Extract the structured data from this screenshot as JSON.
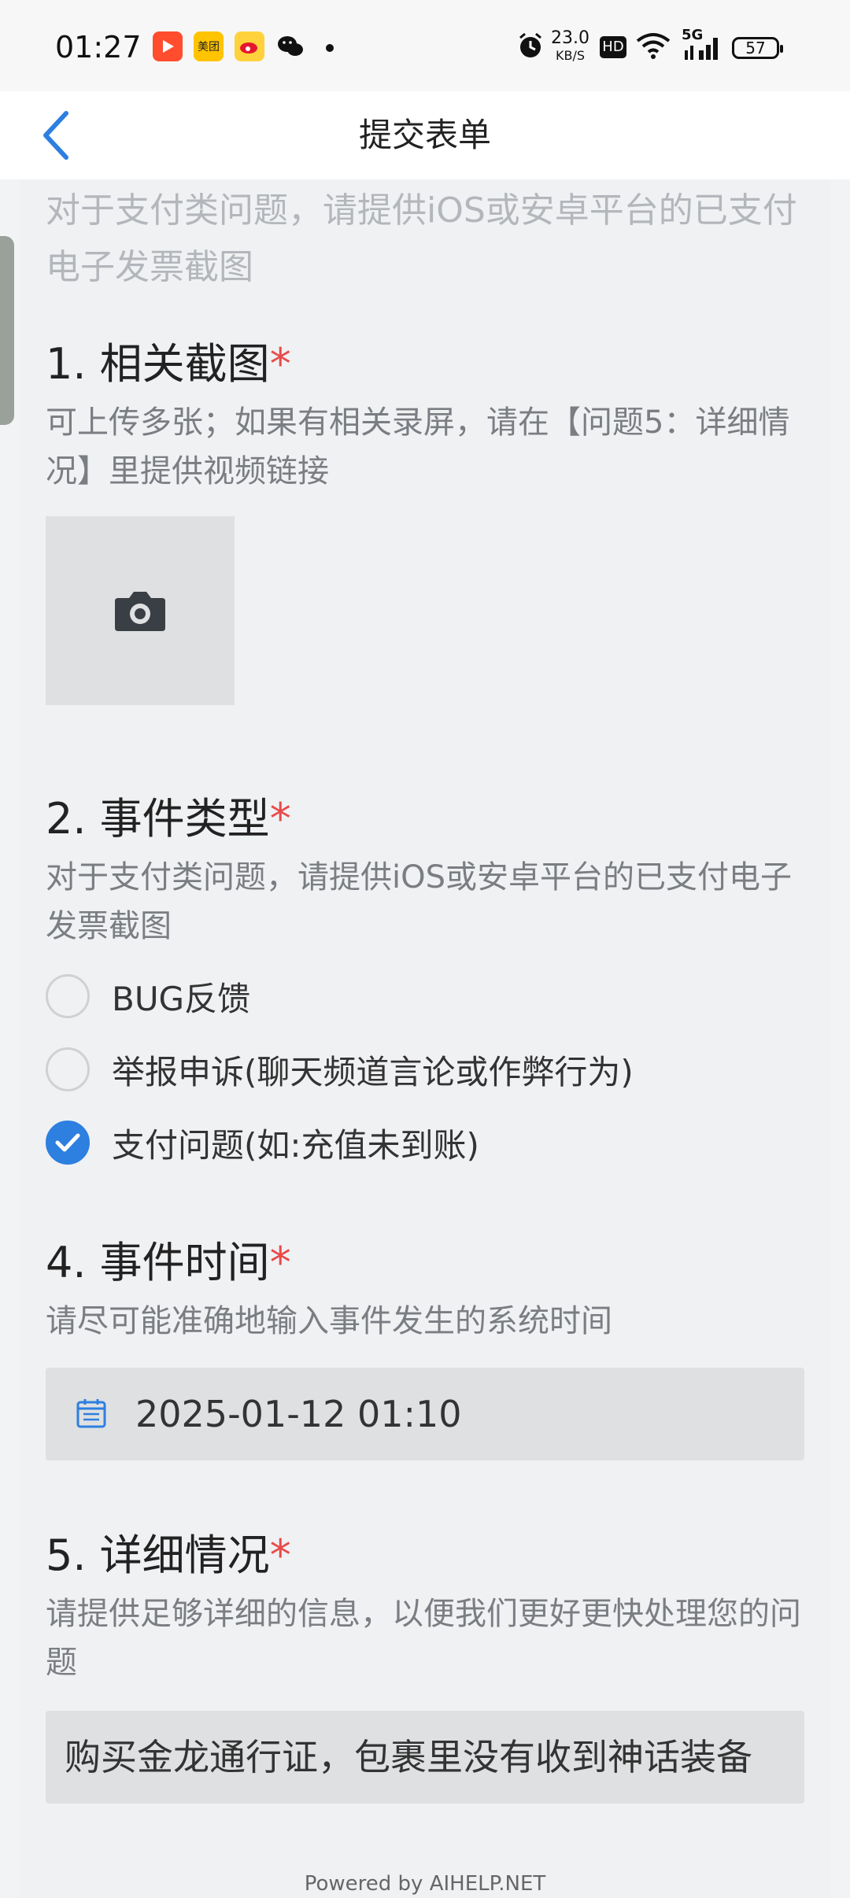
{
  "status_bar": {
    "time": "01:27",
    "net_speed": "23.0",
    "net_unit": "KB/S",
    "hd": "HD",
    "signal": "5G",
    "battery": "57",
    "app_icons": [
      "video-app-icon",
      "meituan-icon",
      "weibo-icon",
      "wechat-icon"
    ],
    "meituan_label": "美团"
  },
  "nav": {
    "title": "提交表单"
  },
  "intro": "对于支付类问题，请提供iOS或安卓平台的已支付电子发票截图",
  "q1": {
    "title": "1. 相关截图",
    "required": "*",
    "desc": "可上传多张；如果有相关录屏，请在【问题5：详细情况】里提供视频链接"
  },
  "q2": {
    "title": "2. 事件类型",
    "required": "*",
    "desc": "对于支付类问题，请提供iOS或安卓平台的已支付电子发票截图",
    "options": [
      {
        "label": "BUG反馈",
        "checked": false
      },
      {
        "label": "举报申诉(聊天频道言论或作弊行为)",
        "checked": false
      },
      {
        "label": "支付问题(如:充值未到账)",
        "checked": true
      }
    ]
  },
  "q4": {
    "title": "4. 事件时间",
    "required": "*",
    "desc": "请尽可能准确地输入事件发生的系统时间",
    "value": "2025-01-12 01:10"
  },
  "q5": {
    "title": "5. 详细情况",
    "required": "*",
    "desc": "请提供足够详细的信息，以便我们更好更快处理您的问题",
    "value": "购买金龙通行证，包裹里没有收到神话装备"
  },
  "footer": "Powered by AIHELP.NET",
  "colors": {
    "accent": "#2d7fe0",
    "required": "#e84a4a",
    "page_bg": "#f0f1f3",
    "field_bg": "#dfe0e2"
  }
}
